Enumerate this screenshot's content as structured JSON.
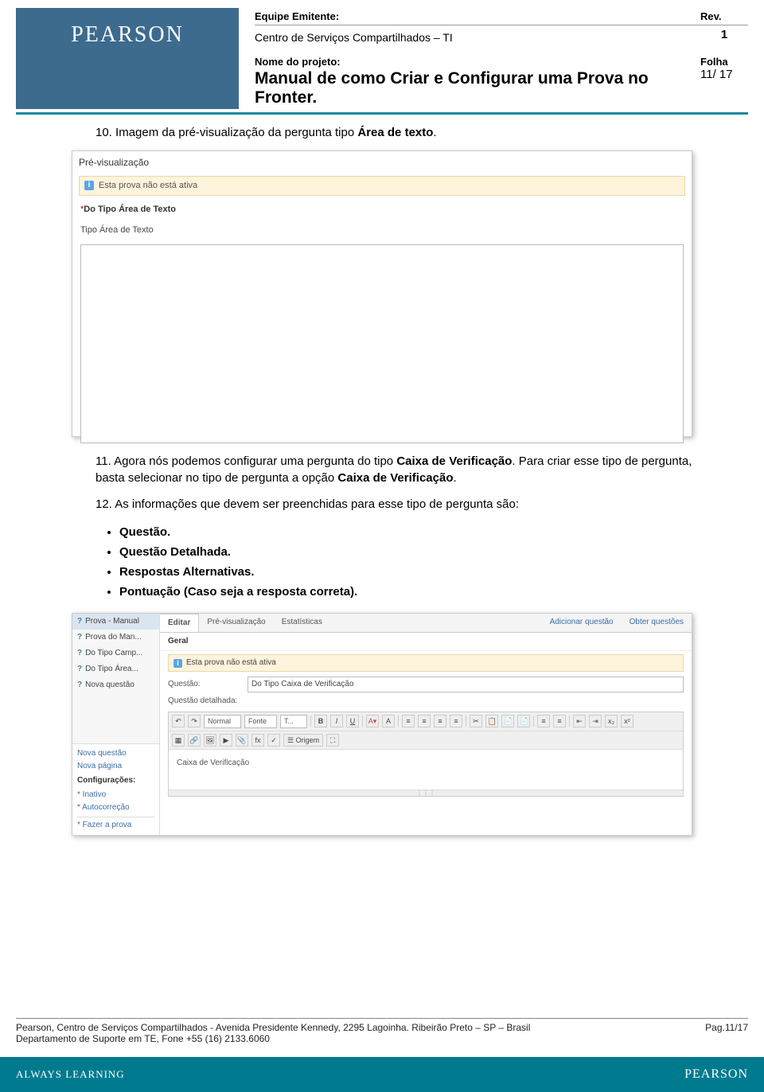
{
  "header": {
    "logo": "PEARSON",
    "team_label": "Equipe Emitente:",
    "rev_label": "Rev.",
    "team_value": "Centro de Serviços Compartilhados – TI",
    "rev_value": "1",
    "project_label": "Nome do projeto:",
    "page_label": "Folha",
    "project_title": "Manual de como Criar e Configurar uma Prova no Fronter.",
    "page_value": "11/ 17"
  },
  "body": {
    "p10_num": "10.",
    "p10_text_a": " Imagem da pré-visualização da pergunta tipo ",
    "p10_bold": "Área de texto",
    "p10_text_b": ".",
    "shot1": {
      "title": "Pré-visualização",
      "info": "Esta prova não está ativa",
      "q_label": "Do Tipo Área de Texto",
      "sub": "Tipo Área de Texto"
    },
    "p11_num": "11.",
    "p11_text_a": " Agora nós podemos configurar uma pergunta do tipo ",
    "p11_bold1": "Caixa de Verificação",
    "p11_text_b": ". Para criar esse tipo de pergunta, basta selecionar no tipo de pergunta a opção ",
    "p11_bold2": "Caixa de Verificação",
    "p11_text_c": ".",
    "p12_num": "12.",
    "p12_text": " As informações que devem ser preenchidas para esse tipo de pergunta são:",
    "bullets": {
      "b1": "Questão.",
      "b2": "Questão Detalhada.",
      "b3": "Respostas Alternativas.",
      "b4": "Pontuação (Caso seja a resposta correta)."
    },
    "shot2": {
      "side": {
        "item0": "Prova - Manual",
        "item1": "Prova do Man...",
        "item2": "Do Tipo Camp...",
        "item3": "Do Tipo Área...",
        "item4": "Nova questão",
        "novaq": "Nova questão",
        "novap": "Nova página",
        "config": "Configurações:",
        "inativo": "* Inativo",
        "autocor": "* Autocorreção",
        "fazer": "* Fazer a prova"
      },
      "tabs": {
        "editar": "Editar",
        "previs": "Pré-visualização",
        "estat": "Estatísticas",
        "addq": "Adicionar questão",
        "obter": "Obter questões"
      },
      "geral": "Geral",
      "info": "Esta prova não está ativa",
      "questao_lbl": "Questão:",
      "questao_val": "Do Tipo Caixa de Verificação",
      "qdet": "Questão detalhada:",
      "toolbar": {
        "normal": "Normal",
        "fonte": "Fonte",
        "t": "T..."
      },
      "editor_text": "Caixa de Verificação",
      "origem": "Origem"
    }
  },
  "footer": {
    "line1": "Pearson, Centro de Serviços Compartilhados  - Avenida Presidente Kennedy, 2295 Lagoinha. Ribeirão Preto – SP – Brasil",
    "line2": "Departamento de Suporte em TE, Fone +55 (16) 2133.6060",
    "pag": "Pag.11/17",
    "always": "ALWAYS LEARNING",
    "plogo": "PEARSON"
  }
}
